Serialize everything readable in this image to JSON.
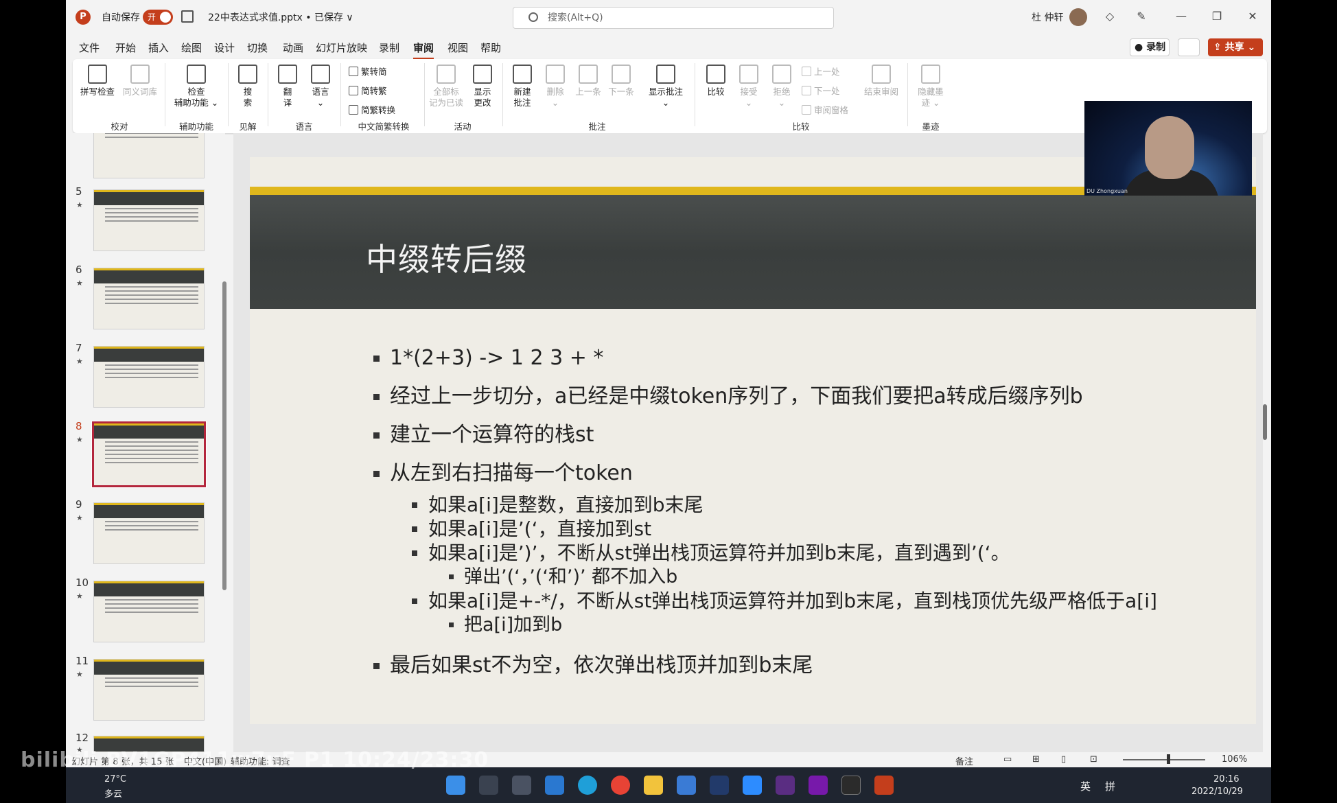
{
  "titlebar": {
    "app_logo": "P",
    "autosave_label": "自动保存",
    "autosave_state": "开",
    "doc_title": "22中表达式求值.pptx • 已保存 ∨",
    "search_placeholder": "搜索(Alt+Q)",
    "user_name": "杜 仲轩"
  },
  "menu": {
    "items": [
      "文件",
      "开始",
      "插入",
      "绘图",
      "设计",
      "切换",
      "动画",
      "幻灯片放映",
      "录制",
      "审阅",
      "视图",
      "帮助"
    ],
    "active": "审阅",
    "record_label": "录制",
    "share_label": "共享"
  },
  "ribbon": {
    "spell_check": "拼写检查",
    "thesaurus": "同义词库",
    "check_accessibility_1": "检查",
    "check_accessibility_2": "辅助功能 ⌄",
    "search_1": "搜",
    "search_2": "索",
    "translate_1": "翻",
    "translate_2": "译",
    "language_1": "语言",
    "language_2": "⌄",
    "trad_to_simp": "繁转简",
    "simp_to_trad": "简转繁",
    "conversion": "简繁转换",
    "mark_read_1": "全部标",
    "mark_read_2": "记为已读",
    "show_changes_1": "显示",
    "show_changes_2": "更改",
    "new_comment_1": "新建",
    "new_comment_2": "批注",
    "delete_1": "删除",
    "delete_2": "⌄",
    "prev_comment": "上一条",
    "next_comment": "下一条",
    "show_comments_1": "显示批注",
    "show_comments_2": "⌄",
    "compare": "比较",
    "accept_1": "接受",
    "accept_2": "⌄",
    "reject_1": "拒绝",
    "reject_2": "⌄",
    "prev_change": "上一处",
    "next_change": "下一处",
    "review_pane": "审阅窗格",
    "end_review": "结束审阅",
    "hide_ink_1": "隐藏墨",
    "hide_ink_2": "迹 ⌄",
    "groups": [
      "校对",
      "辅助功能",
      "见解",
      "语言",
      "中文简繁转换",
      "活动",
      "批注",
      "比较",
      "墨迹"
    ]
  },
  "thumbnails": [
    {
      "num": "5",
      "star": "★"
    },
    {
      "num": "6",
      "star": "★"
    },
    {
      "num": "7",
      "star": "★"
    },
    {
      "num": "8",
      "star": "★"
    },
    {
      "num": "9",
      "star": "★"
    },
    {
      "num": "10",
      "star": "★"
    },
    {
      "num": "11",
      "star": "★"
    },
    {
      "num": "12",
      "star": "★"
    }
  ],
  "slide": {
    "title": "中缀转后缀",
    "b1": "1*(2+3) -> 1 2 3 + *",
    "b2": "经过上一步切分，a已经是中缀token序列了，下面我们要把a转成后缀序列b",
    "b3": "建立一个运算符的栈st",
    "b4": "从左到右扫描每一个token",
    "b4_1": "如果a[i]是整数，直接加到b末尾",
    "b4_2": "如果a[i]是’(‘，直接加到st",
    "b4_3": "如果a[i]是’)’，不断从st弹出栈顶运算符并加到b末尾，直到遇到’(‘。",
    "b4_3_1": "弹出’(‘，’(‘和’)’ 都不加入b",
    "b4_4": "如果a[i]是+-*/，不断从st弹出栈顶运算符并加到b末尾，直到栈顶优先级严格低于a[i]",
    "b4_4_1": "把a[i]加到b",
    "b5": "最后如果st不为空，依次弹出栈顶并加到b末尾"
  },
  "webcam": {
    "name": "DU Zhongxuan"
  },
  "statusbar": {
    "slide_info": "幻灯片 第 8 张，共 15 张",
    "language": "中文(中国)",
    "accessibility": "辅助功能: 调查",
    "notes": "备注",
    "zoom": "106%"
  },
  "taskbar": {
    "temp": "27°C",
    "weather": "多云",
    "ime_lang": "英",
    "ime_mode": "拼",
    "time": "20:16",
    "date": "2022/10/29"
  },
  "watermark": "bilibili BV1GP411w7uF P1 10:24/23:30",
  "colors": {
    "accent": "#c43e1c",
    "slide_header": "#3e4241",
    "slide_stripe": "#e0b71c",
    "slide_bg": "#efede6",
    "selected_thumb": "#b3263c"
  }
}
